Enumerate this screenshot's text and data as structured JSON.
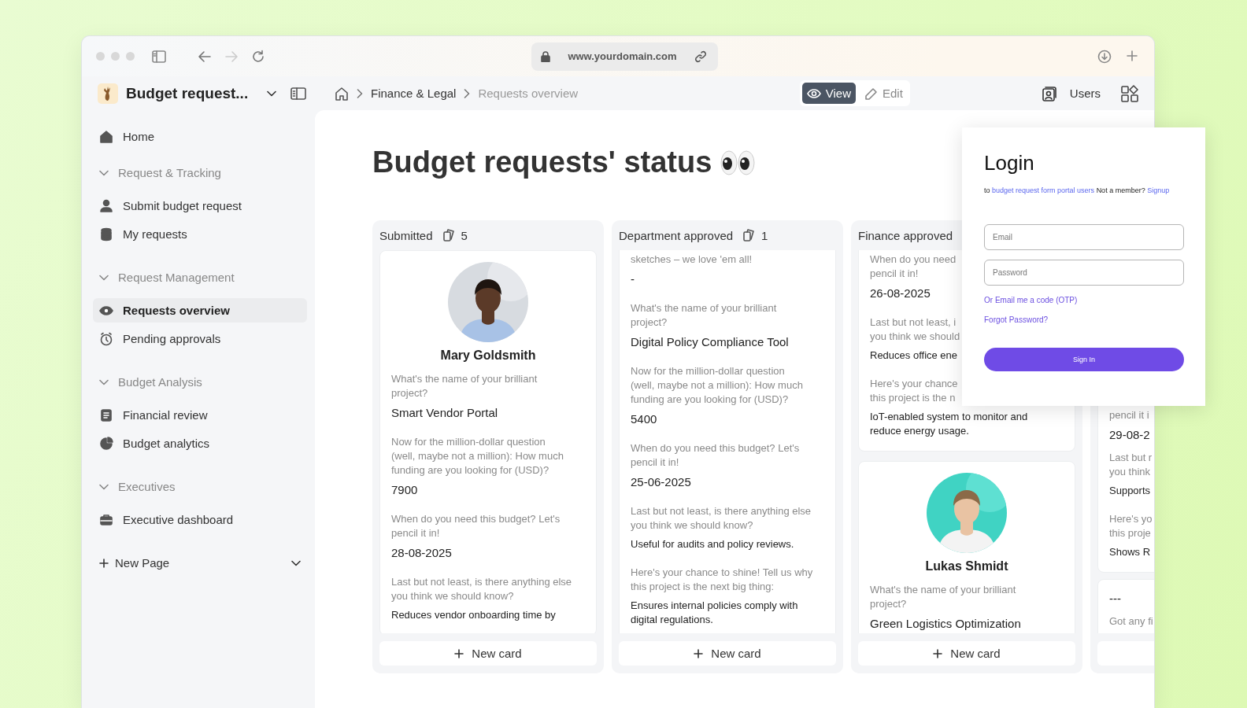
{
  "browser": {
    "url": "www.yourdomain.com",
    "forward_disabled": true
  },
  "app": {
    "title": "Budget request..."
  },
  "breadcrumbs": [
    {
      "label": "Finance & Legal",
      "current": false
    },
    {
      "label": "Requests overview",
      "current": true
    }
  ],
  "mode_toggle": [
    {
      "label": "View",
      "selected": true
    },
    {
      "label": "Edit",
      "selected": false
    }
  ],
  "toolbar": {
    "users_label": "Users"
  },
  "sidebar": {
    "items": [
      {
        "kind": "link",
        "label": "Home",
        "selected": false
      },
      {
        "kind": "group",
        "label": "Request & Tracking",
        "expanded": true,
        "children": [
          {
            "label": "Submit budget request",
            "selected": false
          },
          {
            "label": "My requests",
            "selected": false
          }
        ]
      },
      {
        "kind": "group",
        "label": "Request Management",
        "expanded": true,
        "children": [
          {
            "label": "Requests overview",
            "selected": true
          },
          {
            "label": "Pending approvals",
            "selected": false
          }
        ]
      },
      {
        "kind": "group",
        "label": "Budget Analysis",
        "expanded": true,
        "children": [
          {
            "label": "Financial review",
            "selected": false
          },
          {
            "label": "Budget analytics",
            "selected": false
          }
        ]
      },
      {
        "kind": "group",
        "label": "Executives",
        "expanded": true,
        "children": [
          {
            "label": "Executive dashboard",
            "selected": false
          }
        ]
      }
    ],
    "new_page": "New Page"
  },
  "page": {
    "title": "Budget requests' status"
  },
  "board": {
    "columns": [
      {
        "title": "Submitted",
        "count": "5",
        "new_card": "New card",
        "cards": [
          {
            "fields": [
              {
                "kind": "picture"
              },
              {
                "kind": "name",
                "lines": [
                  "Mary Goldsmith"
                ]
              },
              {
                "kind": "question",
                "lines": [
                  "What's the name of your brilliant",
                  "project?"
                ]
              },
              {
                "kind": "value",
                "lines": [
                  "Smart Vendor Portal"
                ]
              },
              {
                "kind": "question",
                "lines": [
                  "Now for the million-dollar question",
                  "(well, maybe not a million): How much",
                  "funding are you looking for (USD)?"
                ]
              },
              {
                "kind": "value",
                "lines": [
                  "7900"
                ]
              },
              {
                "kind": "question",
                "lines": [
                  "When do you need this budget? Let's",
                  "pencil it in!"
                ]
              },
              {
                "kind": "value",
                "lines": [
                  "28-08-2025"
                ]
              },
              {
                "kind": "question",
                "lines": [
                  "Last but not least, is there anything else",
                  "you think we should know?"
                ]
              },
              {
                "kind": "answer",
                "lines": [
                  "Reduces vendor onboarding time by"
                ]
              }
            ]
          }
        ]
      },
      {
        "title": "Department approved",
        "count": "1",
        "new_card": "New card",
        "cards": [
          {
            "fields": [
              {
                "kind": "question",
                "lines": [
                  "sketches – we love 'em all!"
                ]
              },
              {
                "kind": "value",
                "lines": [
                  "-"
                ]
              },
              {
                "kind": "question",
                "lines": [
                  "What's the name of your brilliant",
                  "project?"
                ]
              },
              {
                "kind": "value",
                "lines": [
                  "Digital Policy Compliance Tool"
                ]
              },
              {
                "kind": "question",
                "lines": [
                  "Now for the million-dollar question",
                  "(well, maybe not a million): How much",
                  "funding are you looking for (USD)?"
                ]
              },
              {
                "kind": "value",
                "lines": [
                  "5400"
                ]
              },
              {
                "kind": "question",
                "lines": [
                  "When do you need this budget? Let's",
                  "pencil it in!"
                ]
              },
              {
                "kind": "value",
                "lines": [
                  "25-06-2025"
                ]
              },
              {
                "kind": "question",
                "lines": [
                  "Last but not least, is there anything else",
                  "you think we should know?"
                ]
              },
              {
                "kind": "answer",
                "lines": [
                  "Useful for audits and policy reviews."
                ]
              },
              {
                "kind": "question",
                "lines": [
                  "Here's your chance to shine! Tell us why",
                  "this project is the next big thing:"
                ]
              },
              {
                "kind": "answer",
                "lines": [
                  "Ensures internal policies comply with",
                  "digital regulations."
                ]
              }
            ]
          }
        ]
      },
      {
        "title": "Finance approved",
        "new_card": "New card",
        "cards": [
          {
            "fields": [
              {
                "kind": "question",
                "lines": [
                  "When do you need",
                  "pencil it in!"
                ]
              },
              {
                "kind": "value",
                "lines": [
                  "26-08-2025"
                ]
              },
              {
                "kind": "question",
                "lines": [
                  "Last but not least, i",
                  "you think we should"
                ]
              },
              {
                "kind": "answer",
                "lines": [
                  "Reduces office ene"
                ]
              },
              {
                "kind": "question",
                "lines": [
                  "Here's your chance",
                  "this project is the n"
                ]
              },
              {
                "kind": "answer",
                "lines": [
                  "IoT-enabled system to monitor and",
                  "reduce energy usage."
                ]
              }
            ]
          },
          {
            "fields": [
              {
                "kind": "picture"
              },
              {
                "kind": "name",
                "lines": [
                  "Lukas Shmidt"
                ]
              },
              {
                "kind": "question",
                "lines": [
                  "What's the name of your brilliant",
                  "project?"
                ]
              },
              {
                "kind": "value",
                "lines": [
                  "Green Logistics Optimization"
                ]
              }
            ]
          }
        ]
      },
      {
        "cards": [
          {
            "fields": [
              {
                "kind": "question",
                "lines": [
                  "pencil it i"
                ]
              },
              {
                "kind": "value",
                "lines": [
                  "29-08-2"
                ]
              },
              {
                "kind": "question",
                "lines": [
                  "Last but r",
                  "you think"
                ]
              },
              {
                "kind": "answer",
                "lines": [
                  "Supports"
                ]
              },
              {
                "kind": "question",
                "lines": [
                  "Here's yo",
                  "this proje"
                ]
              },
              {
                "kind": "answer",
                "lines": [
                  "Shows R"
                ]
              }
            ]
          },
          {
            "fields": [
              {
                "kind": "value",
                "lines": [
                  "---"
                ]
              },
              {
                "kind": "question",
                "lines": [
                  "Got any fi"
                ]
              }
            ]
          }
        ]
      }
    ]
  },
  "login": {
    "title": "Login",
    "subtitle": [
      {
        "kind": "text",
        "text": "to"
      },
      {
        "kind": "link",
        "text": "budget request form portal users"
      },
      {
        "kind": "text",
        "text": "Not a member?"
      },
      {
        "kind": "link",
        "text": "Signup"
      }
    ],
    "email_placeholder": "Email",
    "password_placeholder": "Password",
    "otp_link": "Or Email me a code (OTP)",
    "forgot_link": "Forgot Password?",
    "submit": "Sign In"
  }
}
